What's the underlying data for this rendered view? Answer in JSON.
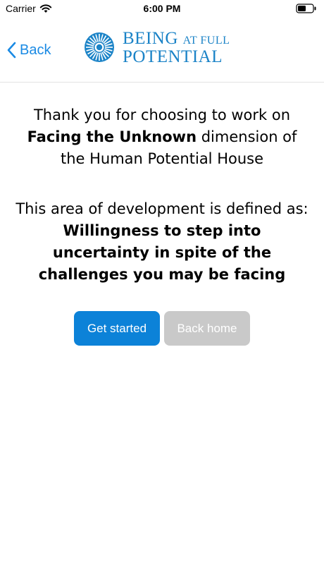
{
  "status_bar": {
    "carrier": "Carrier",
    "time": "6:00 PM",
    "icons": [
      "wifi-icon",
      "battery-icon"
    ]
  },
  "nav": {
    "back_label": "Back",
    "back_icon": "chevron-left-icon",
    "logo": {
      "line1_main": "BEING",
      "line1_small": "AT FULL",
      "line2": "POTENTIAL",
      "color": "#1b83c7"
    }
  },
  "content": {
    "intro_before": "Thank you for choosing to work on",
    "dimension": "Facing the Unknown",
    "intro_after": "dimension of the Human Potential House",
    "definition_label": "This area of development is defined as:",
    "definition": "Willingness to step into uncertainty in spite of the challenges you may be facing"
  },
  "buttons": {
    "get_started": "Get started",
    "back_home": "Back home",
    "primary_color": "#0c82d8",
    "secondary_color": "#c9c9c9"
  }
}
